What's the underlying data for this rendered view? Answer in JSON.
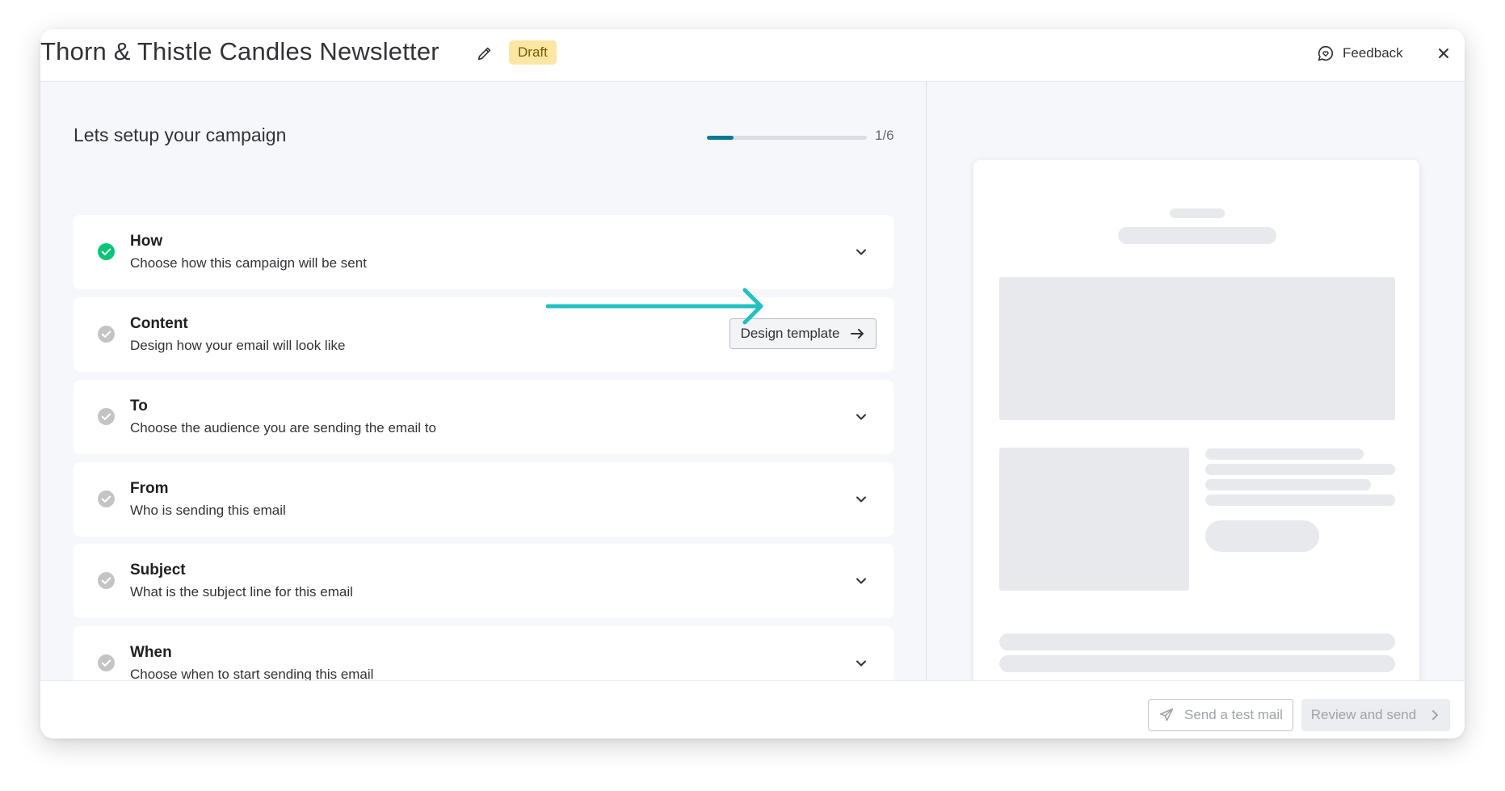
{
  "header": {
    "title": "Thorn & Thistle Candles Newsletter",
    "status_badge": "Draft",
    "feedback_label": "Feedback"
  },
  "setup": {
    "title": "Lets setup your campaign",
    "progress_text": "1/6",
    "progress_fraction": 0.1667
  },
  "steps": [
    {
      "title": "How",
      "description": "Choose how this campaign will be sent",
      "status": "complete"
    },
    {
      "title": "Content",
      "description": "Design how your email will look like",
      "status": "pending",
      "action_label": "Design template"
    },
    {
      "title": "To",
      "description": "Choose the audience you are sending the email to",
      "status": "pending"
    },
    {
      "title": "From",
      "description": "Who is sending this email",
      "status": "pending"
    },
    {
      "title": "Subject",
      "description": "What is the subject line for this email",
      "status": "pending"
    },
    {
      "title": "When",
      "description": "Choose when to start sending this email",
      "status": "pending"
    }
  ],
  "footer": {
    "test_mail_label": "Send a test mail",
    "review_label": "Review and send"
  },
  "colors": {
    "accent": "#0b7a8f",
    "complete": "#00c875",
    "pending": "#c4c4c4",
    "annotation_arrow": "#1fc1c7",
    "badge_bg": "#fbe6a4"
  },
  "icons": [
    "edit-pencil-icon",
    "feedback-chat-icon",
    "close-icon",
    "check-circle-icon",
    "chevron-down-icon",
    "arrow-right-icon",
    "send-plane-icon",
    "chevron-right-icon"
  ]
}
